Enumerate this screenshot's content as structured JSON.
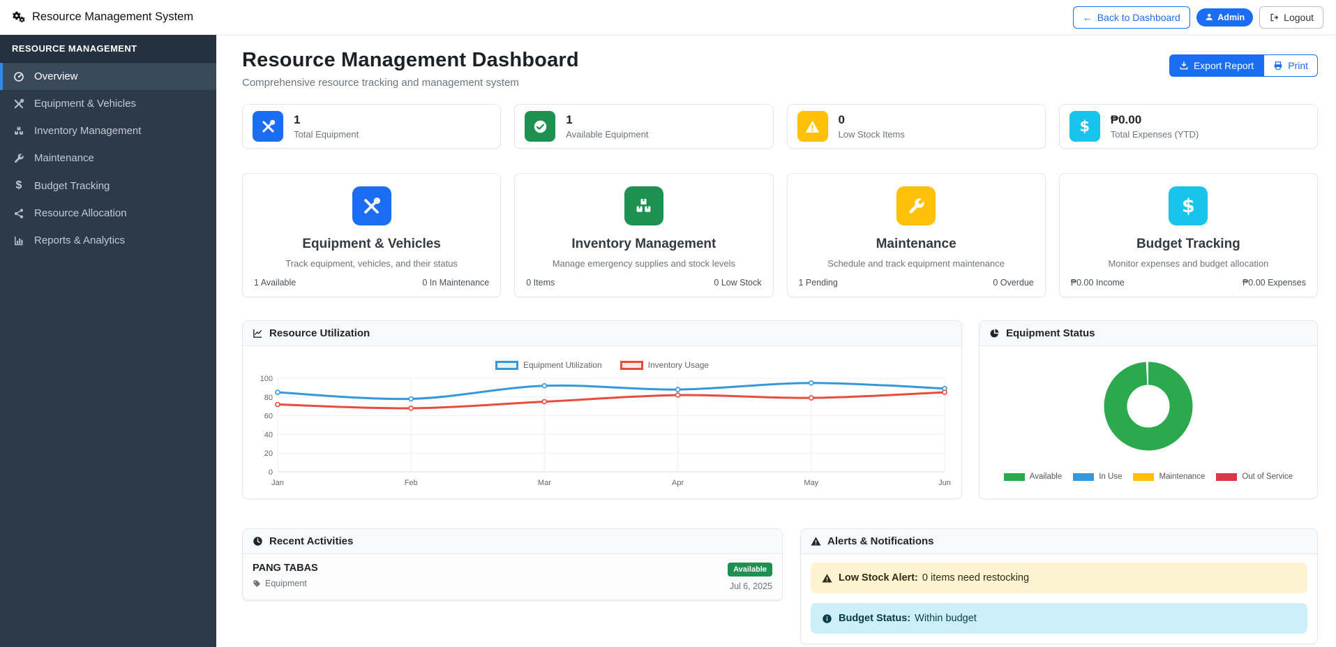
{
  "app": {
    "title": "Resource Management System"
  },
  "navbar": {
    "back_button": "Back to Dashboard",
    "admin_badge": "Admin",
    "logout_button": "Logout"
  },
  "sidebar": {
    "header": "RESOURCE MANAGEMENT",
    "items": [
      {
        "label": "Overview",
        "icon": "tachometer-icon",
        "active": true
      },
      {
        "label": "Equipment & Vehicles",
        "icon": "tools-icon",
        "active": false
      },
      {
        "label": "Inventory Management",
        "icon": "boxes-icon",
        "active": false
      },
      {
        "label": "Maintenance",
        "icon": "wrench-icon",
        "active": false
      },
      {
        "label": "Budget Tracking",
        "icon": "dollar-icon",
        "active": false
      },
      {
        "label": "Resource Allocation",
        "icon": "share-icon",
        "active": false
      },
      {
        "label": "Reports & Analytics",
        "icon": "bar-chart-icon",
        "active": false
      }
    ]
  },
  "header": {
    "title": "Resource Management Dashboard",
    "subtitle": "Comprehensive resource tracking and management system",
    "export_button": "Export Report",
    "print_button": "Print"
  },
  "colors": {
    "primary": "#1b6ef3",
    "success": "#1e9150",
    "warning": "#ffc107",
    "info_cyan": "#17c4ec",
    "danger": "#dc3545",
    "sidebar_bg": "#2c3a4a",
    "chart_blue": "#3498db",
    "chart_red": "#e74c3c",
    "chart_green": "#2ba94d"
  },
  "stats": [
    {
      "value": "1",
      "label": "Total Equipment",
      "icon": "tools-icon",
      "color": "#1b6ef3"
    },
    {
      "value": "1",
      "label": "Available Equipment",
      "icon": "check-circle-icon",
      "color": "#1e9150"
    },
    {
      "value": "0",
      "label": "Low Stock Items",
      "icon": "warning-icon",
      "color": "#ffc107"
    },
    {
      "value": "₱0.00",
      "label": "Total Expenses (YTD)",
      "icon": "peso-icon",
      "color": "#17c4ec"
    }
  ],
  "modules": [
    {
      "title": "Equipment & Vehicles",
      "description": "Track equipment, vehicles, and their status",
      "stat_left": "1 Available",
      "stat_right": "0 In Maintenance",
      "icon": "tools-icon",
      "color": "#1b6ef3"
    },
    {
      "title": "Inventory Management",
      "description": "Manage emergency supplies and stock levels",
      "stat_left": "0 Items",
      "stat_right": "0 Low Stock",
      "icon": "boxes-icon",
      "color": "#1e9150"
    },
    {
      "title": "Maintenance",
      "description": "Schedule and track equipment maintenance",
      "stat_left": "1 Pending",
      "stat_right": "0 Overdue",
      "icon": "wrench-icon",
      "color": "#ffc107"
    },
    {
      "title": "Budget Tracking",
      "description": "Monitor expenses and budget allocation",
      "stat_left": "₱0.00 Income",
      "stat_right": "₱0.00 Expenses",
      "icon": "dollar-icon",
      "color": "#17c4ec"
    }
  ],
  "panels": {
    "utilization_title": "Resource Utilization",
    "status_title": "Equipment Status",
    "recent_title": "Recent Activities",
    "alerts_title": "Alerts & Notifications"
  },
  "chart_data": [
    {
      "type": "line",
      "title": "Resource Utilization",
      "x": [
        "Jan",
        "Feb",
        "Mar",
        "Apr",
        "May",
        "Jun"
      ],
      "series": [
        {
          "name": "Equipment Utilization",
          "color": "#3498db",
          "values": [
            85,
            78,
            92,
            88,
            95,
            89
          ]
        },
        {
          "name": "Inventory Usage",
          "color": "#e74c3c",
          "values": [
            72,
            68,
            75,
            82,
            79,
            85
          ]
        }
      ],
      "ylim": [
        0,
        100
      ],
      "yticks": [
        0,
        20,
        40,
        60,
        80,
        100
      ],
      "grid": true,
      "legend_position": "top"
    },
    {
      "type": "pie",
      "title": "Equipment Status",
      "donut": true,
      "labels": [
        "Available",
        "In Use",
        "Maintenance",
        "Out of Service"
      ],
      "values": [
        1,
        0,
        0,
        0
      ],
      "colors": [
        "#2ba94d",
        "#3498db",
        "#ffc107",
        "#dc3545"
      ],
      "legend_position": "bottom"
    }
  ],
  "recent": {
    "items": [
      {
        "name": "PANG TABAS",
        "category": "Equipment",
        "status": "Available",
        "date": "Jul 6, 2025",
        "status_color": "#1e9150"
      }
    ]
  },
  "alerts": {
    "items": [
      {
        "type": "warning",
        "label": "Low Stock Alert:",
        "text": "0 items need restocking"
      },
      {
        "type": "info",
        "label": "Budget Status:",
        "text": "Within budget"
      }
    ]
  }
}
